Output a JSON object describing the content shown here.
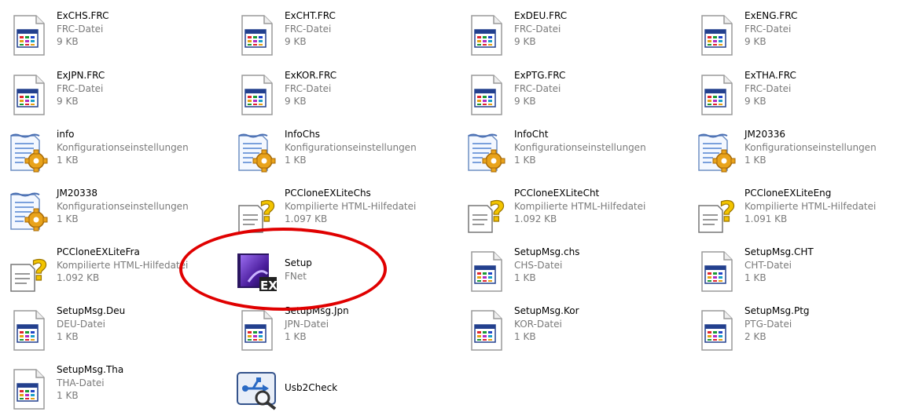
{
  "files": [
    {
      "name": "ExCHS.FRC",
      "type": "FRC-Datei",
      "size": "9 KB",
      "icon": "frc-file-icon"
    },
    {
      "name": "ExCHT.FRC",
      "type": "FRC-Datei",
      "size": "9 KB",
      "icon": "frc-file-icon"
    },
    {
      "name": "ExDEU.FRC",
      "type": "FRC-Datei",
      "size": "9 KB",
      "icon": "frc-file-icon"
    },
    {
      "name": "ExENG.FRC",
      "type": "FRC-Datei",
      "size": "9 KB",
      "icon": "frc-file-icon"
    },
    {
      "name": "ExJPN.FRC",
      "type": "FRC-Datei",
      "size": "9 KB",
      "icon": "frc-file-icon"
    },
    {
      "name": "ExKOR.FRC",
      "type": "FRC-Datei",
      "size": "9 KB",
      "icon": "frc-file-icon"
    },
    {
      "name": "ExPTG.FRC",
      "type": "FRC-Datei",
      "size": "9 KB",
      "icon": "frc-file-icon"
    },
    {
      "name": "ExTHA.FRC",
      "type": "FRC-Datei",
      "size": "9 KB",
      "icon": "frc-file-icon"
    },
    {
      "name": "info",
      "type": "Konfigurationseinstellungen",
      "size": "1 KB",
      "icon": "config-settings-icon"
    },
    {
      "name": "InfoChs",
      "type": "Konfigurationseinstellungen",
      "size": "1 KB",
      "icon": "config-settings-icon"
    },
    {
      "name": "InfoCht",
      "type": "Konfigurationseinstellungen",
      "size": "1 KB",
      "icon": "config-settings-icon"
    },
    {
      "name": "JM20336",
      "type": "Konfigurationseinstellungen",
      "size": "1 KB",
      "icon": "config-settings-icon"
    },
    {
      "name": "JM20338",
      "type": "Konfigurationseinstellungen",
      "size": "1 KB",
      "icon": "config-settings-icon"
    },
    {
      "name": "PCCloneEXLiteChs",
      "type": "Kompilierte HTML-Hilfedatei",
      "size": "1.097 KB",
      "icon": "help-file-icon"
    },
    {
      "name": "PCCloneEXLiteCht",
      "type": "Kompilierte HTML-Hilfedatei",
      "size": "1.092 KB",
      "icon": "help-file-icon"
    },
    {
      "name": "PCCloneEXLiteEng",
      "type": "Kompilierte HTML-Hilfedatei",
      "size": "1.091 KB",
      "icon": "help-file-icon"
    },
    {
      "name": "PCCloneEXLiteFra",
      "type": "Kompilierte HTML-Hilfedatei",
      "size": "1.092 KB",
      "icon": "help-file-icon"
    },
    {
      "name": "Setup",
      "type": "FNet",
      "size": "",
      "icon": "setup-app-icon"
    },
    {
      "name": "SetupMsg.chs",
      "type": "CHS-Datei",
      "size": "1 KB",
      "icon": "frc-file-icon"
    },
    {
      "name": "SetupMsg.CHT",
      "type": "CHT-Datei",
      "size": "1 KB",
      "icon": "frc-file-icon"
    },
    {
      "name": "SetupMsg.Deu",
      "type": "DEU-Datei",
      "size": "1 KB",
      "icon": "frc-file-icon"
    },
    {
      "name": "SetupMsg.Jpn",
      "type": "JPN-Datei",
      "size": "1 KB",
      "icon": "frc-file-icon"
    },
    {
      "name": "SetupMsg.Kor",
      "type": "KOR-Datei",
      "size": "1 KB",
      "icon": "frc-file-icon"
    },
    {
      "name": "SetupMsg.Ptg",
      "type": "PTG-Datei",
      "size": "2 KB",
      "icon": "frc-file-icon"
    },
    {
      "name": "SetupMsg.Tha",
      "type": "THA-Datei",
      "size": "1 KB",
      "icon": "frc-file-icon"
    },
    {
      "name": "Usb2Check",
      "type": "",
      "size": "",
      "icon": "usb-check-icon"
    }
  ],
  "highlight": {
    "target": "Setup",
    "color": "#e00000"
  }
}
